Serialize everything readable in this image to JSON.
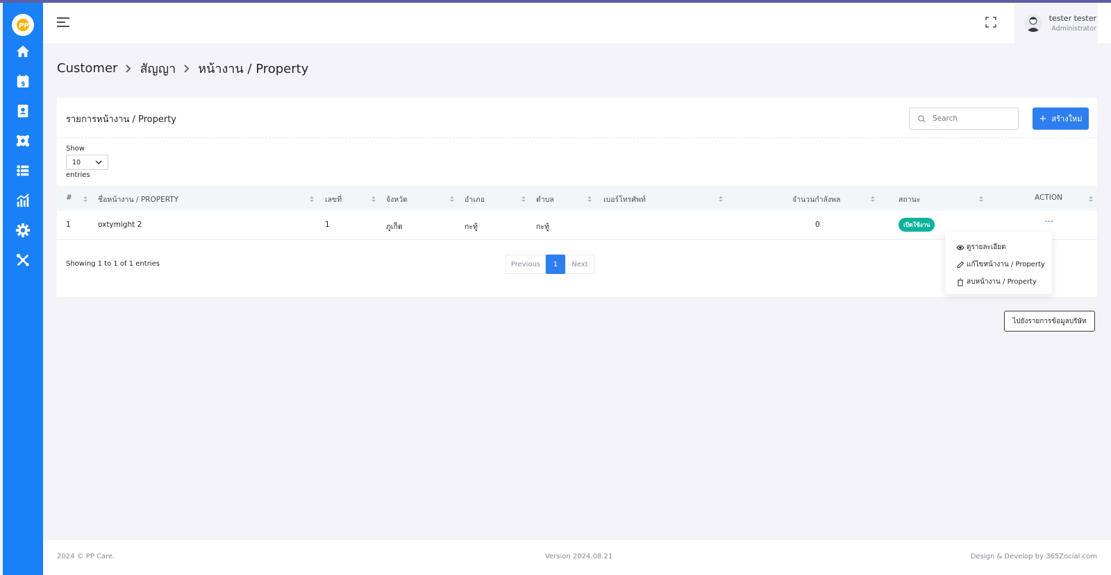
{
  "header": {
    "user_name": "tester tester",
    "user_role": "Administrator"
  },
  "breadcrumb": [
    "Customer",
    "สัญญา",
    "หน้างาน / Property"
  ],
  "card": {
    "title": "รายการหน้างาน / Property",
    "search_placeholder": "Search",
    "create_label": "สร้างใหม่",
    "show_label": "Show",
    "entries_value": "10",
    "entries_label": "entries"
  },
  "table": {
    "columns": [
      "#",
      "ชื่อหน้างาน / PROPERTY",
      "เลขที่",
      "จังหวัด",
      "อำเภอ",
      "ตำบล",
      "เบอร์โทรศัพท์",
      "จำนวนกำลังพล",
      "สถานะ",
      "ACTION"
    ],
    "rows": [
      {
        "no": "1",
        "name": "oxtymight 2",
        "number": "1",
        "province": "ภูเก็ต",
        "district": "กะทู้",
        "subdistrict": "กะทู้",
        "phone": "",
        "staff": "0",
        "status": "เปิดใช้งาน",
        "action": "···"
      }
    ]
  },
  "showing_text": "Showing 1 to 1 of 1 entries",
  "pagination": {
    "previous": "Previous",
    "current": "1",
    "next": "Next"
  },
  "action_menu": {
    "view": "ดูรายละเอียด",
    "edit": "แก้ไขหน้างาน / Property",
    "delete": "ลบหน้างาน / Property"
  },
  "back_button": "ไปยังรายการข้อมูลบริษัท",
  "footer": {
    "left": "2024 © PP Care.",
    "center": "Version 2024.08.21",
    "right": "Design & Develop by 365Zocial.com"
  },
  "colors": {
    "sidebar": "#1a80f5",
    "primary": "#2d7ff0",
    "success": "#0ab39c"
  }
}
